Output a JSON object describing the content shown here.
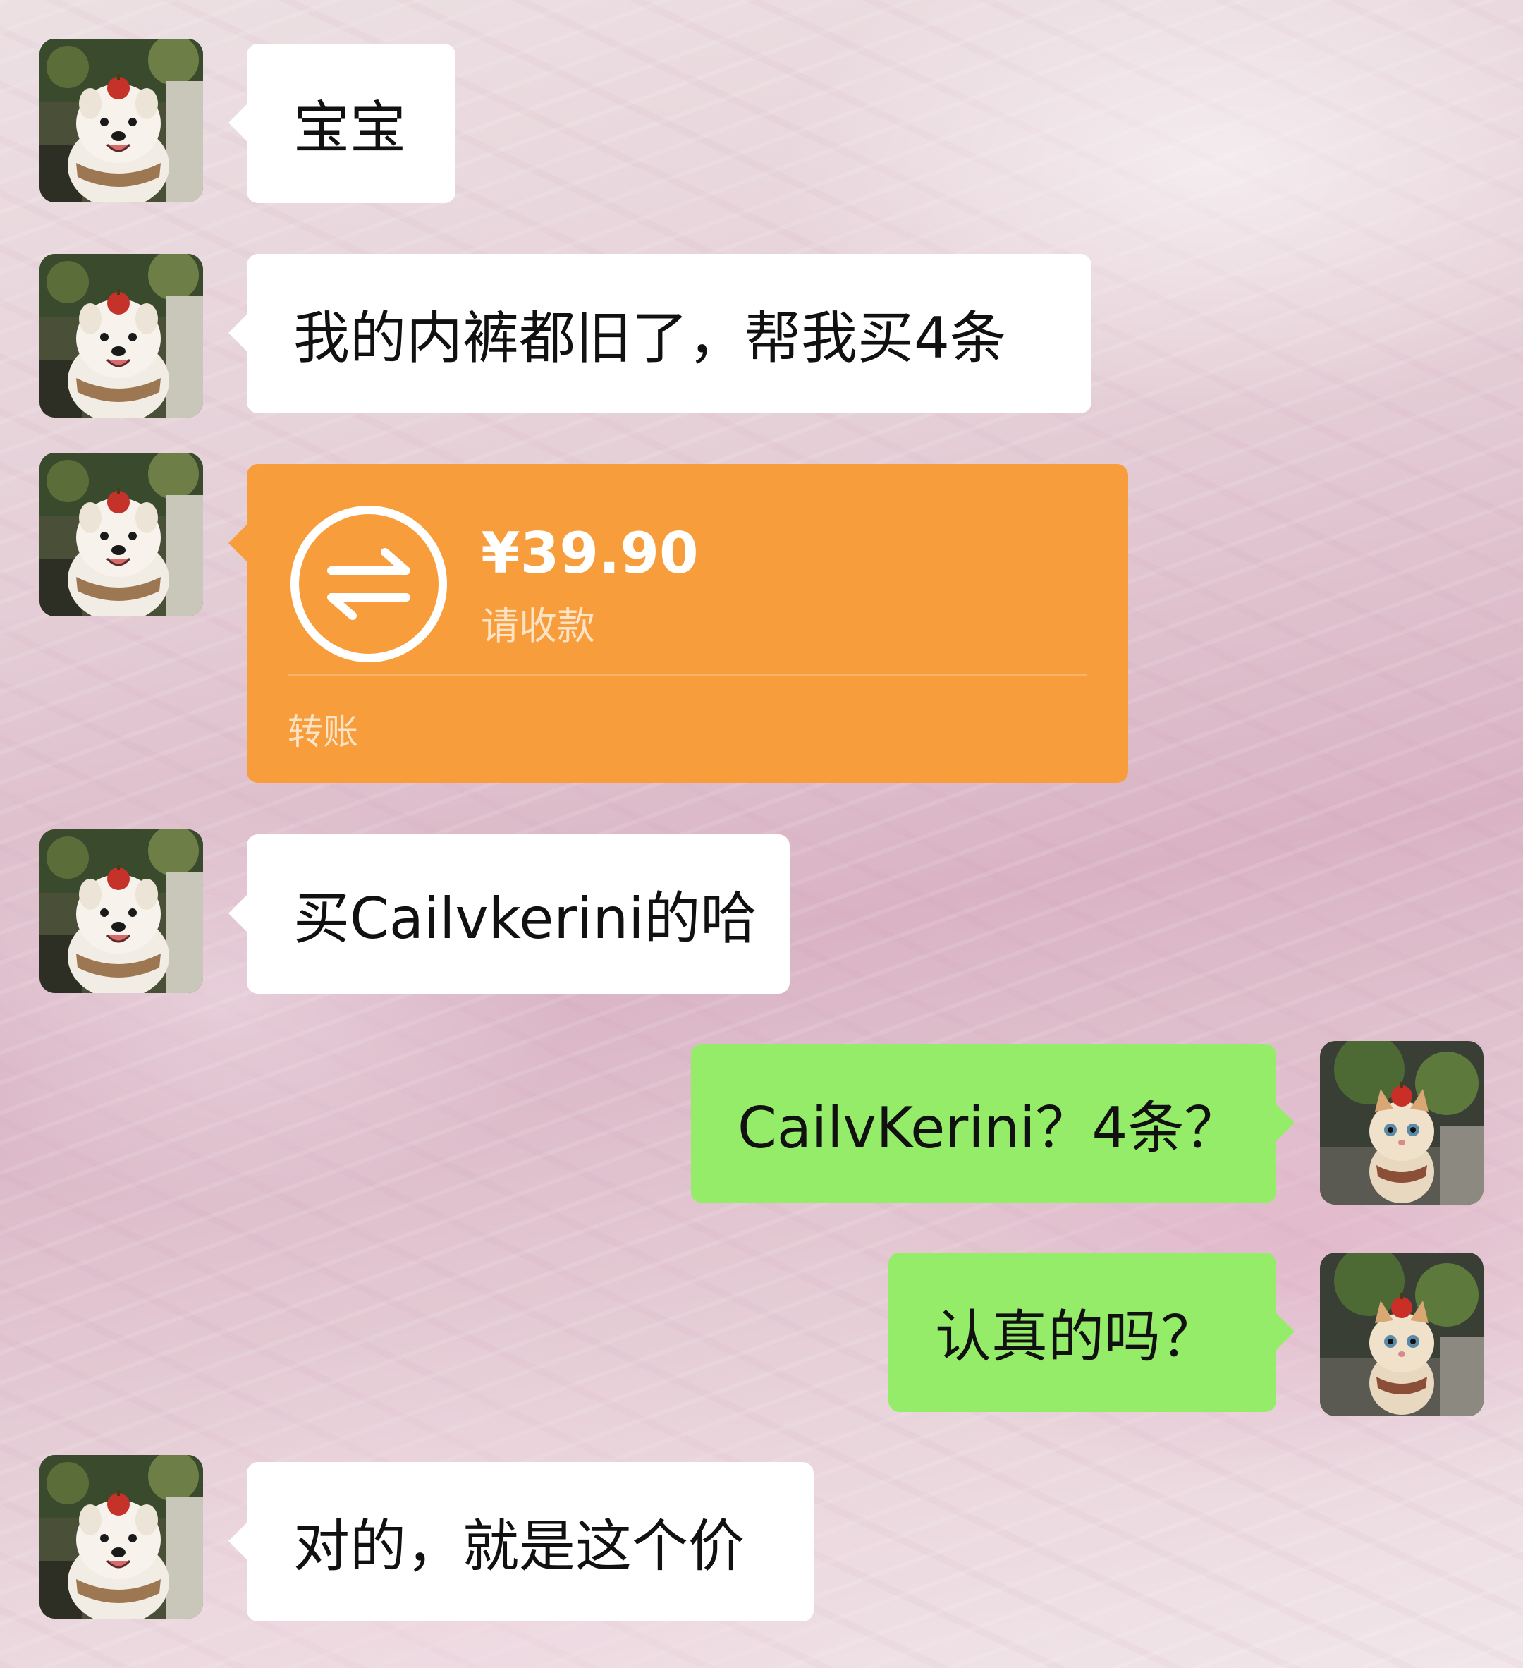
{
  "messages": [
    {
      "sender": "other",
      "text": "宝宝"
    },
    {
      "sender": "other",
      "text": "我的内裤都旧了，帮我买4条"
    },
    {
      "sender": "other",
      "type": "transfer",
      "amount": "¥39.90",
      "status": "请收款",
      "footer": "转账"
    },
    {
      "sender": "other",
      "text": "买Cailvkerini的哈"
    },
    {
      "sender": "me",
      "text": "CailvKerini？4条？"
    },
    {
      "sender": "me",
      "text": "认真的吗？"
    },
    {
      "sender": "other",
      "text": "对的，就是这个价"
    }
  ],
  "avatars": {
    "other": "dog-avatar",
    "me": "cat-avatar"
  },
  "colors": {
    "incoming_bubble": "#ffffff",
    "outgoing_bubble": "#95ec69",
    "transfer_card": "#f89d3b"
  }
}
